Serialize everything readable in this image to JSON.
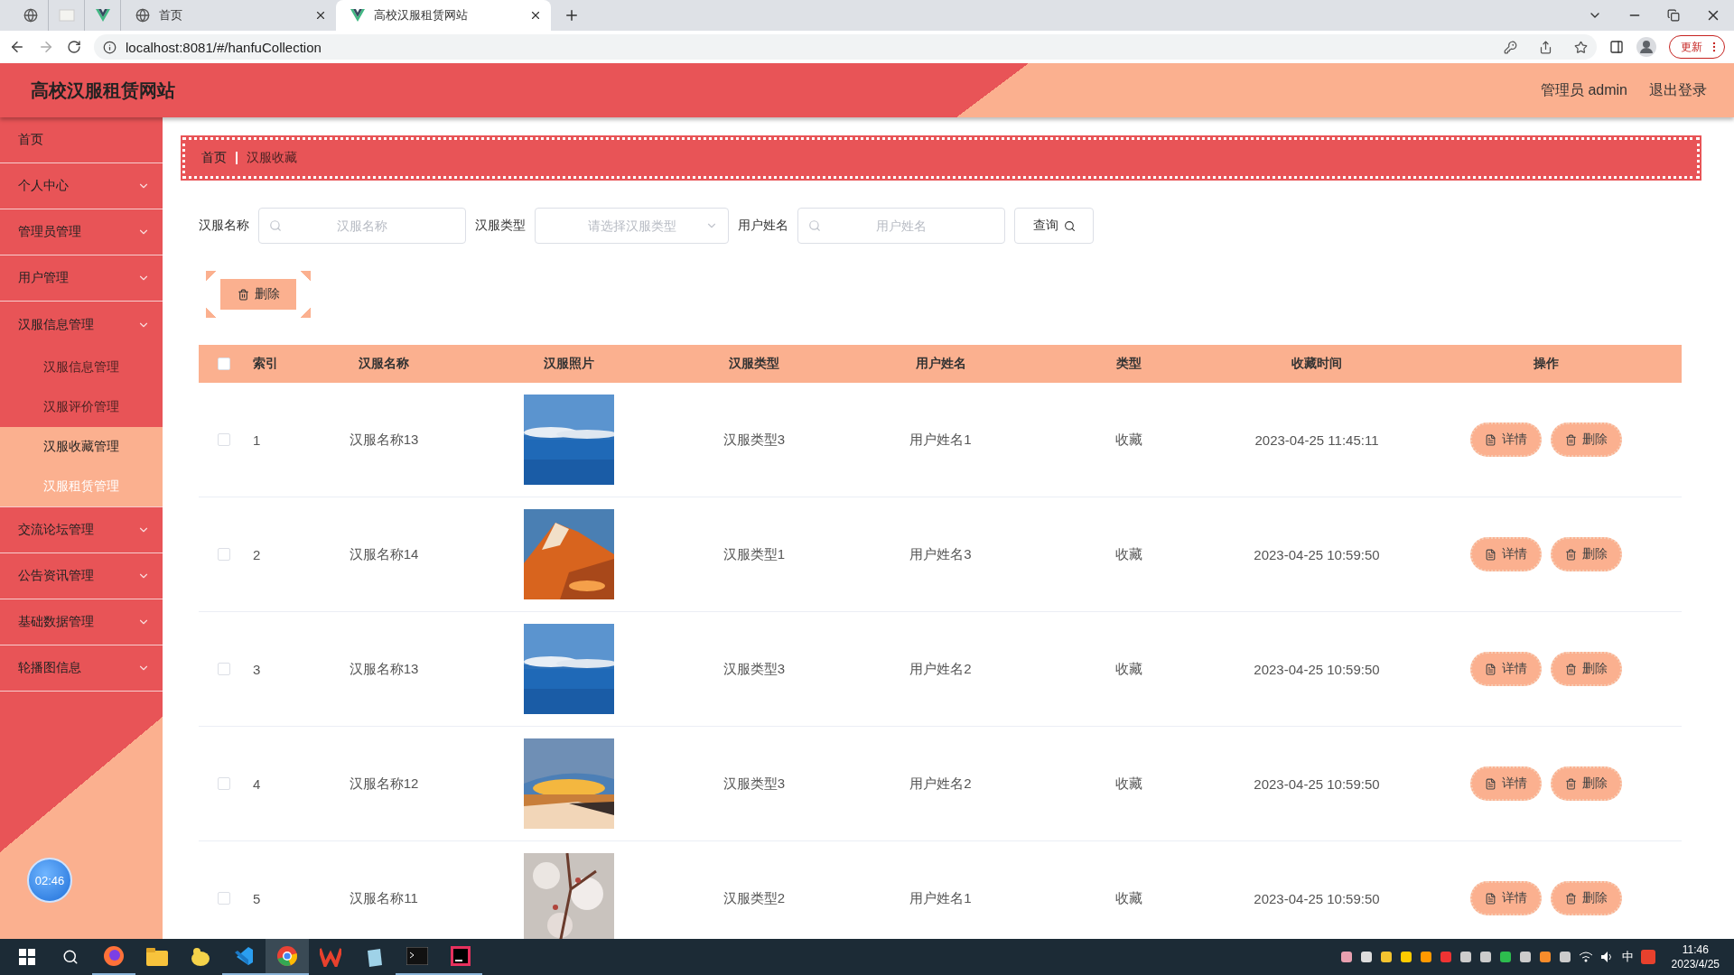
{
  "browser": {
    "tabs": [
      {
        "title": "首页",
        "selected": false
      },
      {
        "title": "高校汉服租赁网站",
        "selected": true
      }
    ],
    "address": "localhost:8081/#/hanfuCollection",
    "update_button": "更新"
  },
  "header": {
    "title": "高校汉服租赁网站",
    "user": "管理员 admin",
    "logout": "退出登录"
  },
  "sidebar": {
    "items": [
      {
        "kind": "link",
        "label": "首页"
      },
      {
        "kind": "group",
        "label": "个人中心"
      },
      {
        "kind": "group",
        "label": "管理员管理"
      },
      {
        "kind": "group",
        "label": "用户管理"
      },
      {
        "kind": "group",
        "label": "汉服信息管理",
        "expanded": true,
        "children": [
          {
            "label": "汉服信息管理",
            "selected": false,
            "hovered": false
          },
          {
            "label": "汉服评价管理",
            "selected": false,
            "hovered": false
          },
          {
            "label": "汉服收藏管理",
            "selected": true,
            "hovered": false
          },
          {
            "label": "汉服租赁管理",
            "selected": false,
            "hovered": true
          }
        ]
      },
      {
        "kind": "group",
        "label": "交流论坛管理"
      },
      {
        "kind": "group",
        "label": "公告资讯管理"
      },
      {
        "kind": "group",
        "label": "基础数据管理"
      },
      {
        "kind": "group",
        "label": "轮播图信息"
      }
    ]
  },
  "breadcrumb": [
    "首页",
    "汉服收藏"
  ],
  "filters": [
    {
      "kind": "search",
      "label": "汉服名称",
      "placeholder": "汉服名称"
    },
    {
      "kind": "select",
      "label": "汉服类型",
      "placeholder": "请选择汉服类型"
    },
    {
      "kind": "search",
      "label": "用户姓名",
      "placeholder": "用户姓名"
    }
  ],
  "query_button": "查询",
  "delete_button": "删除",
  "table": {
    "all_checked": false,
    "columns": [
      "索引",
      "汉服名称",
      "汉服照片",
      "汉服类型",
      "用户姓名",
      "类型",
      "收藏时间",
      "操作"
    ],
    "rows": [
      {
        "checked": false,
        "index": "1",
        "name": "汉服名称13",
        "type": "汉服类型3",
        "user": "用户姓名1",
        "kind": "收藏",
        "time": "2023-04-25 11:45:11",
        "actions": [
          "详情",
          "删除"
        ]
      },
      {
        "checked": false,
        "index": "2",
        "name": "汉服名称14",
        "type": "汉服类型1",
        "user": "用户姓名3",
        "kind": "收藏",
        "time": "2023-04-25 10:59:50",
        "actions": [
          "详情",
          "删除"
        ]
      },
      {
        "checked": false,
        "index": "3",
        "name": "汉服名称13",
        "type": "汉服类型3",
        "user": "用户姓名2",
        "kind": "收藏",
        "time": "2023-04-25 10:59:50",
        "actions": [
          "详情",
          "删除"
        ]
      },
      {
        "checked": false,
        "index": "4",
        "name": "汉服名称12",
        "type": "汉服类型3",
        "user": "用户姓名2",
        "kind": "收藏",
        "time": "2023-04-25 10:59:50",
        "actions": [
          "详情",
          "删除"
        ]
      },
      {
        "checked": false,
        "index": "5",
        "name": "汉服名称11",
        "type": "汉服类型2",
        "user": "用户姓名1",
        "kind": "收藏",
        "time": "2023-04-25 10:59:50",
        "actions": [
          "详情",
          "删除"
        ]
      }
    ]
  },
  "clock_widget": "02:46",
  "taskbar": {
    "ime": "中",
    "time": "11:46",
    "date": "2023/4/25"
  }
}
